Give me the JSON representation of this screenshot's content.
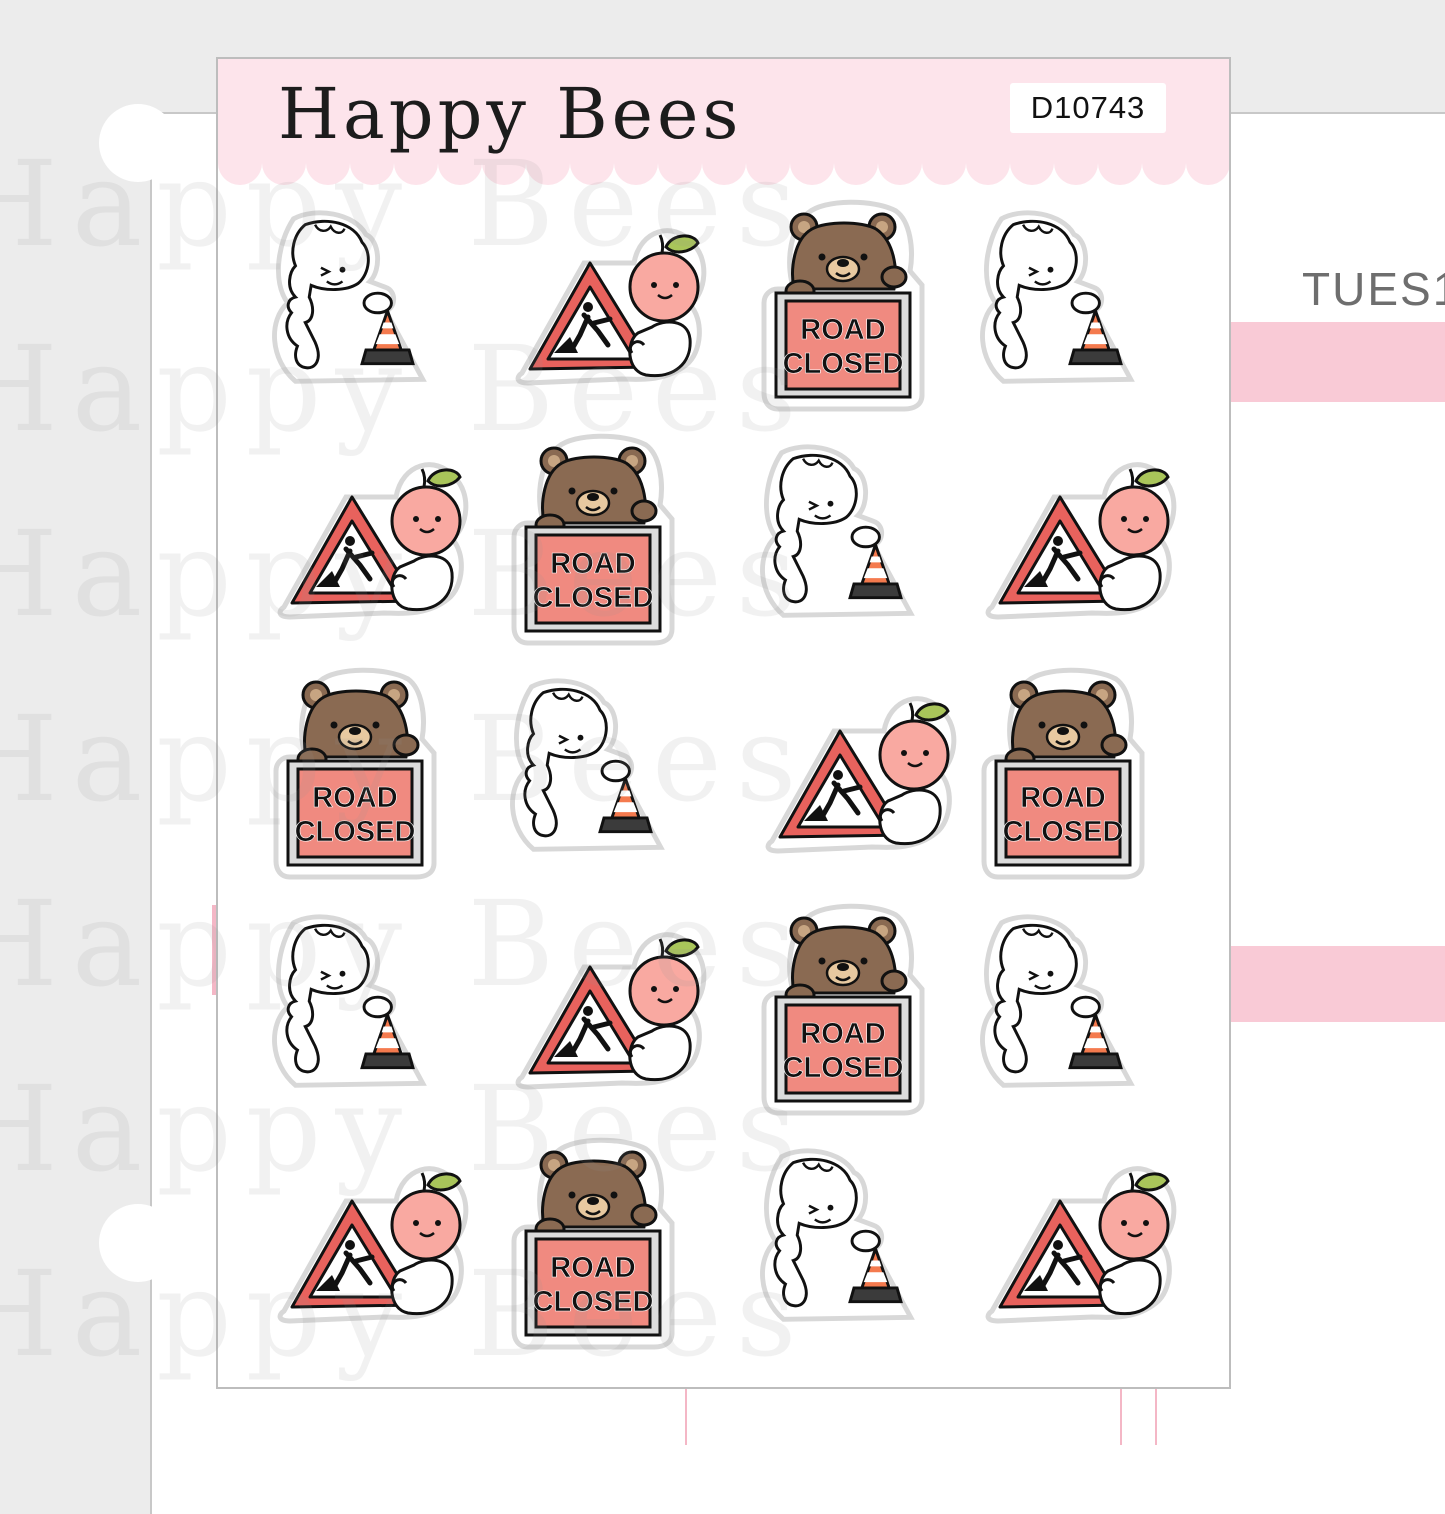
{
  "product": {
    "brand": "Happy Bees",
    "code": "D10743"
  },
  "planner": {
    "day_label": "TUES",
    "day_suffix": "1",
    "paren": ")"
  },
  "stickers": [
    [
      "ghost-cone",
      "peach-sign",
      "bear-road",
      "ghost-cone"
    ],
    [
      "peach-sign",
      "bear-road",
      "ghost-cone",
      "peach-sign"
    ],
    [
      "bear-road",
      "ghost-cone",
      "peach-sign",
      "bear-road"
    ],
    [
      "ghost-cone",
      "peach-sign",
      "bear-road",
      "ghost-cone"
    ],
    [
      "peach-sign",
      "bear-road",
      "ghost-cone",
      "peach-sign"
    ]
  ],
  "road_sign": {
    "line1": "ROAD",
    "line2": "CLOSED"
  },
  "watermark": "Happy Bees",
  "colors": {
    "header_pink": "#fde4eb",
    "sign_red": "#e8625d",
    "sign_fill": "#f08a80",
    "bear_brown": "#8a6a52",
    "cone_orange": "#f47a4e",
    "peach": "#f9a9a1",
    "leaf": "#a9c55a"
  }
}
